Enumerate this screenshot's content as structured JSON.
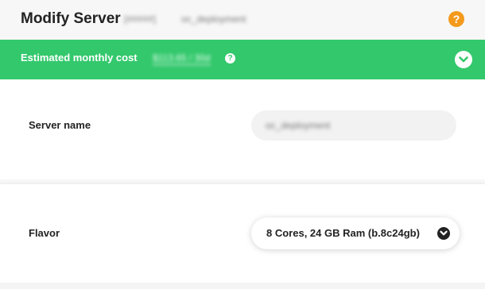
{
  "header": {
    "title": "Modify Server",
    "server_id": "[#####]",
    "server_ident_name": "oc_deployment",
    "help_icon": "question-circle-icon",
    "help_symbol": "?"
  },
  "cost_bar": {
    "label": "Estimated monthly cost",
    "value": "$113.65 / 30d",
    "help_symbol": "?",
    "background_color": "#33c86c",
    "expand_icon": "chevron-down-circle-icon"
  },
  "form": {
    "server_name": {
      "label": "Server name",
      "value": "oc_deployment"
    },
    "flavor": {
      "label": "Flavor",
      "selected": "8 Cores, 24 GB Ram (b.8c24gb)",
      "dropdown_icon": "chevron-down-circle-icon"
    }
  },
  "colors": {
    "accent_green": "#33c86c",
    "help_orange": "#f39a1c"
  }
}
